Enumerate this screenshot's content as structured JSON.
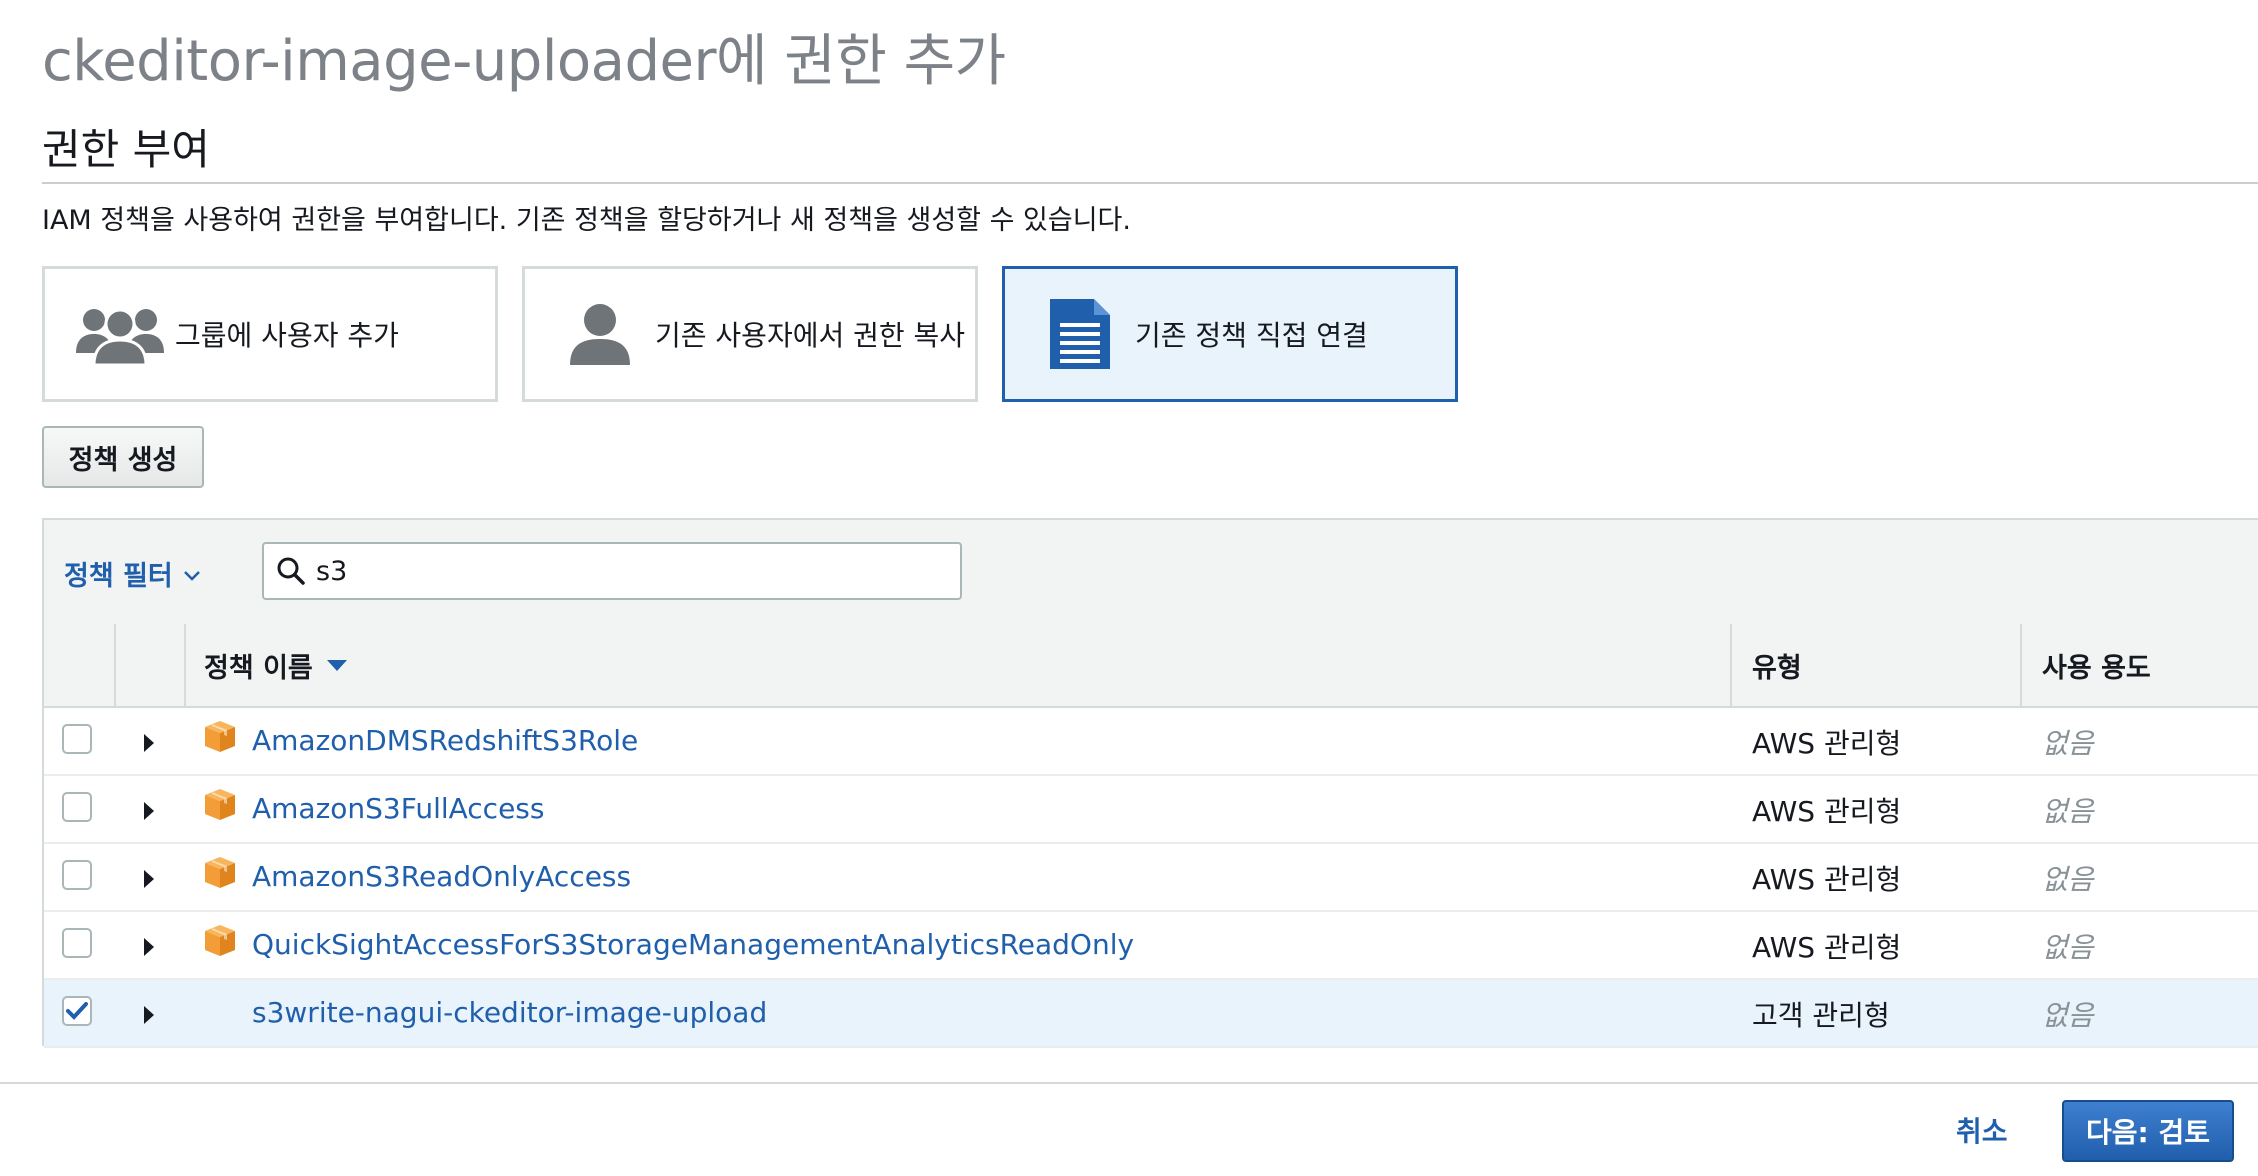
{
  "page": {
    "title": "ckeditor-image-uploader에 권한 추가",
    "section_title": "권한 부여",
    "description": "IAM 정책을 사용하여 권한을 부여합니다. 기존 정책을 할당하거나 새 정책을 생성할 수 있습니다."
  },
  "options": [
    {
      "label": "그룹에 사용자 추가",
      "icon": "users-group-icon",
      "selected": false
    },
    {
      "label": "기존 사용자에서 권한 복사",
      "icon": "user-icon",
      "selected": false
    },
    {
      "label": "기존 정책 직접 연결",
      "icon": "document-icon",
      "selected": true
    }
  ],
  "create_policy_label": "정책 생성",
  "filter": {
    "label": "정책 필터",
    "search_value": "s3"
  },
  "table": {
    "columns": {
      "name": "정책 이름",
      "type": "유형",
      "usage": "사용 용도"
    },
    "rows": [
      {
        "name": "AmazonDMSRedshiftS3Role",
        "type": "AWS 관리형",
        "usage": "없음",
        "checked": false,
        "aws_icon": true
      },
      {
        "name": "AmazonS3FullAccess",
        "type": "AWS 관리형",
        "usage": "없음",
        "checked": false,
        "aws_icon": true
      },
      {
        "name": "AmazonS3ReadOnlyAccess",
        "type": "AWS 관리형",
        "usage": "없음",
        "checked": false,
        "aws_icon": true
      },
      {
        "name": "QuickSightAccessForS3StorageManagementAnalyticsReadOnly",
        "type": "AWS 관리형",
        "usage": "없음",
        "checked": false,
        "aws_icon": true
      },
      {
        "name": "s3write-nagui-ckeditor-image-upload",
        "type": "고객 관리형",
        "usage": "없음",
        "checked": true,
        "aws_icon": false
      }
    ]
  },
  "footer": {
    "cancel_label": "취소",
    "next_label": "다음: 검토"
  },
  "colors": {
    "accent": "#1f5fac",
    "selected_bg": "#e9f3fc",
    "aws_orange": "#f29d38"
  }
}
